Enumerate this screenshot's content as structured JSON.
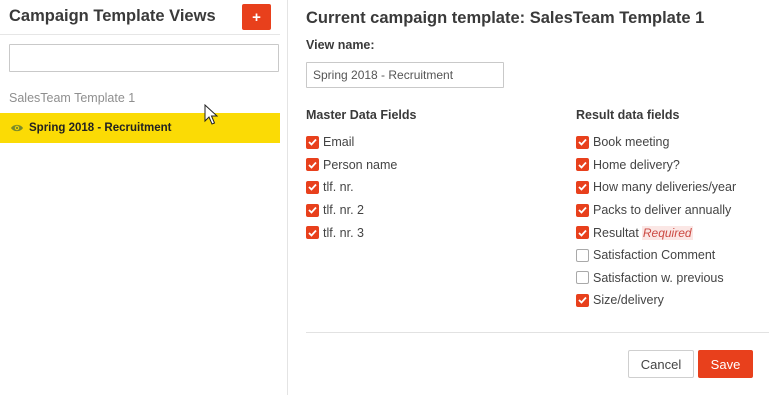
{
  "sidebar": {
    "title": "Campaign Template Views",
    "add_label": "+",
    "search": {
      "value": "",
      "placeholder": ""
    },
    "group_label": "SalesTeam Template 1",
    "items": [
      {
        "label": "Spring 2018 - Recruitment",
        "icon": "eye-icon",
        "selected": true
      }
    ]
  },
  "main": {
    "title": "Current campaign template: SalesTeam Template 1",
    "view_name_label": "View name:",
    "view_name_value": "Spring 2018 - Recruitment",
    "master_heading": "Master Data Fields",
    "result_heading": "Result data fields",
    "master_fields": [
      {
        "label": "Email",
        "checked": true
      },
      {
        "label": "Person name",
        "checked": true
      },
      {
        "label": "tlf. nr.",
        "checked": true
      },
      {
        "label": "tlf. nr. 2",
        "checked": true
      },
      {
        "label": "tlf. nr. 3",
        "checked": true
      }
    ],
    "result_fields": [
      {
        "label": "Book meeting",
        "checked": true
      },
      {
        "label": "Home delivery?",
        "checked": true
      },
      {
        "label": "How many deliveries/year",
        "checked": true
      },
      {
        "label": "Packs to deliver annually",
        "checked": true
      },
      {
        "label": "Resultat",
        "checked": true,
        "badge": "Required"
      },
      {
        "label": "Satisfaction Comment",
        "checked": false
      },
      {
        "label": "Satisfaction w. previous",
        "checked": false
      },
      {
        "label": "Size/delivery",
        "checked": true
      }
    ],
    "cancel_label": "Cancel",
    "save_label": "Save"
  },
  "colors": {
    "accent": "#e8401c",
    "selected_row": "#fbdb05",
    "required_text": "#cc4a43"
  }
}
